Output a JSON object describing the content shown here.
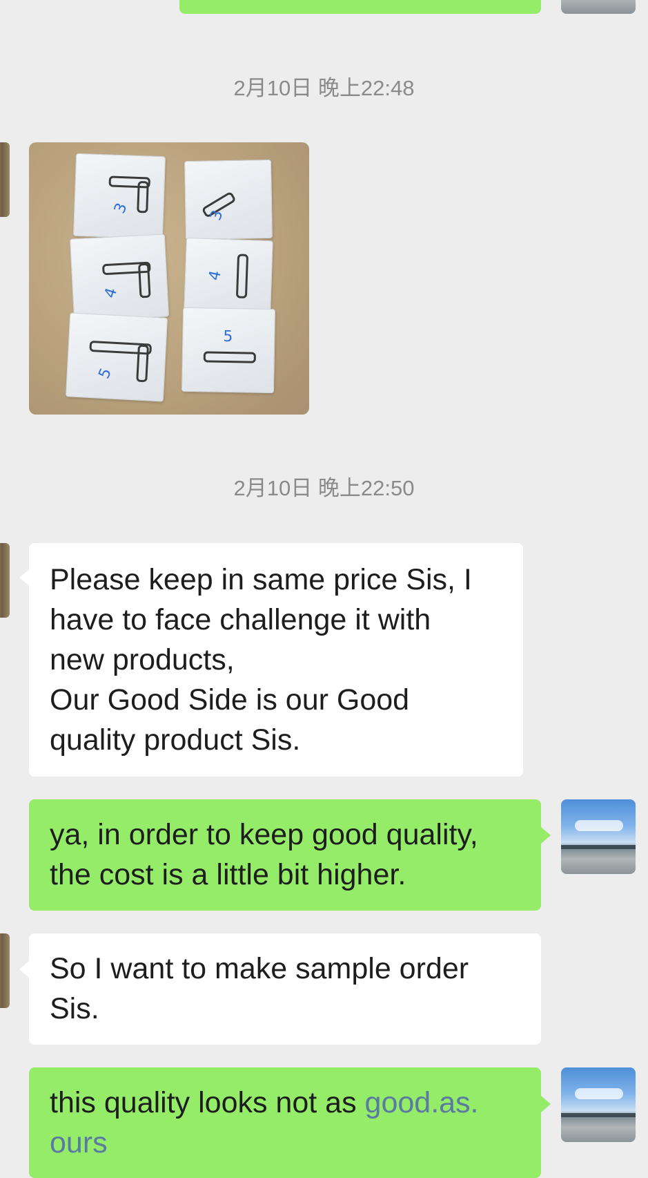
{
  "colors": {
    "background": "#ededed",
    "incoming_bubble": "#ffffff",
    "outgoing_bubble": "#95ec69",
    "timestamp": "#8a8a8a",
    "link": "#5a7aa0"
  },
  "timestamps": [
    "2月10日 晚上22:48",
    "2月10日 晚上22:50"
  ],
  "photo": {
    "labels": [
      "3",
      "3",
      "4",
      "4",
      "5",
      "5"
    ],
    "icon": "photo-of-chain-sample-pouches"
  },
  "messages": [
    {
      "from": "contact",
      "text_lines": [
        "Please keep in same price Sis, I",
        "have to face challenge it with",
        "new products,",
        "Our Good Side is our Good",
        "quality product Sis."
      ]
    },
    {
      "from": "me",
      "text_lines": [
        "ya, in order to keep good quality,",
        "the cost is a little bit higher."
      ]
    },
    {
      "from": "contact",
      "text_lines": [
        "So I want to make sample order",
        "Sis."
      ]
    },
    {
      "from": "me",
      "text_prefix": "this quality looks not as ",
      "link_text_1": "good.as.",
      "link_text_2": "ours"
    }
  ]
}
